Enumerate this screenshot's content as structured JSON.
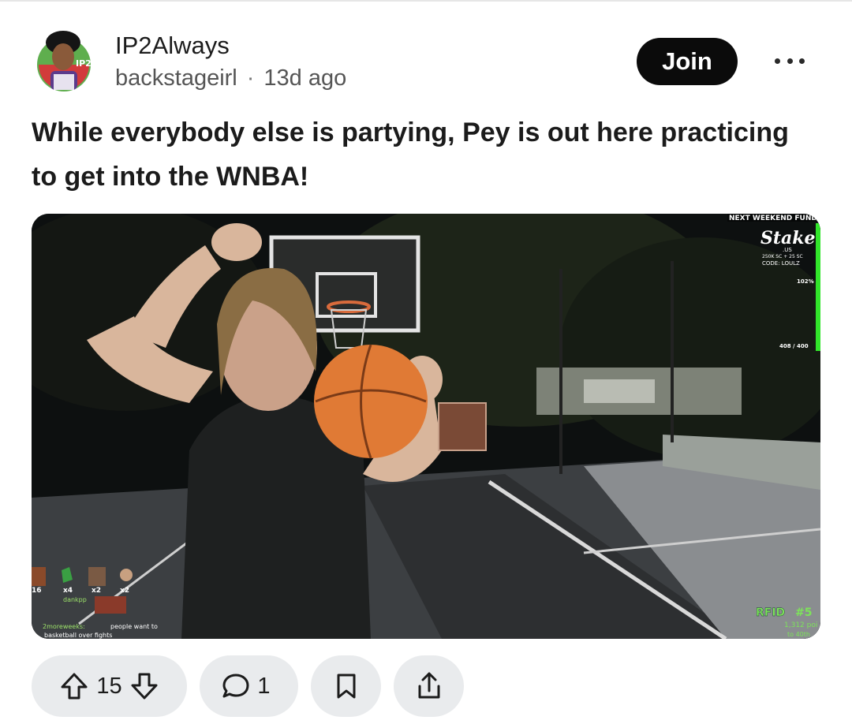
{
  "post": {
    "community": "IP2Always",
    "author": "backstageirl",
    "separator": "·",
    "time": "13d ago",
    "join_label": "Join",
    "title": "While everybody else is partying, Pey is out here practicing to get into the WNBA!",
    "avatar_badge": "IP2"
  },
  "media": {
    "sponsor_header": "NEXT WEEKEND FUND",
    "sponsor_brand": "Stake",
    "sponsor_sub": ".US",
    "sponsor_offer": "250K SC + 25 SC",
    "sponsor_code": "CODE: LOULZ",
    "progress_percent": "102%",
    "progress_count": "408 / 400",
    "progress_fraction": 1.0,
    "rfid_label": "RFID",
    "rfid_number": "#5",
    "rfid_points": "1,312 poi",
    "rfid_sub": "to 40th",
    "chat_badges": [
      "16",
      "x4",
      "x2",
      "x2"
    ],
    "chat_user": "dankpp",
    "chat_message_user": "2moreweeks:",
    "chat_message": "people want to",
    "chat_message_2": "basketball over fights"
  },
  "actions": {
    "upvotes": "15",
    "comments": "1"
  },
  "colors": {
    "join_bg": "#0b0b0b",
    "pill_bg": "#e9ebed",
    "progress_green": "#31e52a",
    "rfid_green": "#7de35a"
  }
}
